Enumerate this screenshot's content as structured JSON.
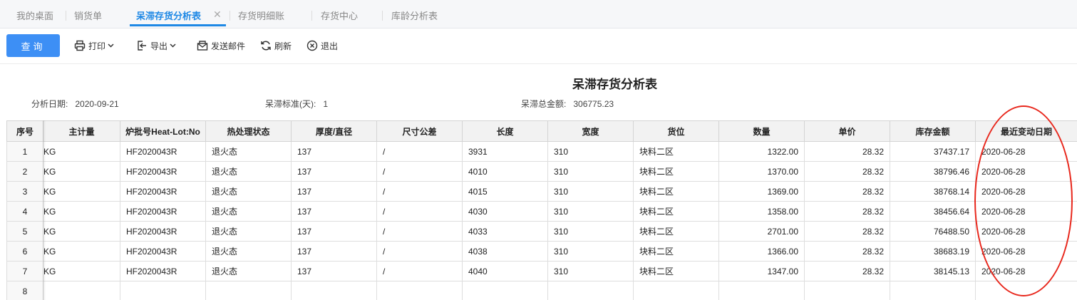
{
  "tabs": [
    {
      "label": "我的桌面",
      "active": false
    },
    {
      "label": "销货单",
      "active": false
    },
    {
      "label": "呆滞存货分析表",
      "active": true
    },
    {
      "label": "存货明细账",
      "active": false
    },
    {
      "label": "存货中心",
      "active": false
    },
    {
      "label": "库龄分析表",
      "active": false
    }
  ],
  "toolbar": {
    "query": "查询",
    "print": "打印",
    "export": "导出",
    "email": "发送邮件",
    "refresh": "刷新",
    "exit": "退出"
  },
  "report": {
    "title": "呆滞存货分析表",
    "analysis_date_label": "分析日期:",
    "analysis_date": "2020-09-21",
    "standard_label": "呆滞标准(天):",
    "standard": "1",
    "total_label": "呆滞总金额:",
    "total": "306775.23"
  },
  "table": {
    "columns": [
      "序号",
      "主计量",
      "炉批号Heat-Lot:No",
      "热处理状态",
      "厚度/直径",
      "尺寸公差",
      "长度",
      "宽度",
      "货位",
      "数量",
      "单价",
      "库存金额",
      "最近变动日期"
    ],
    "rows": [
      [
        "1",
        "KG",
        "HF2020043R",
        "退火态",
        "137",
        "/",
        "3931",
        "310",
        "块料二区",
        "1322.00",
        "28.32",
        "37437.17",
        "2020-06-28"
      ],
      [
        "2",
        "KG",
        "HF2020043R",
        "退火态",
        "137",
        "/",
        "4010",
        "310",
        "块料二区",
        "1370.00",
        "28.32",
        "38796.46",
        "2020-06-28"
      ],
      [
        "3",
        "KG",
        "HF2020043R",
        "退火态",
        "137",
        "/",
        "4015",
        "310",
        "块料二区",
        "1369.00",
        "28.32",
        "38768.14",
        "2020-06-28"
      ],
      [
        "4",
        "KG",
        "HF2020043R",
        "退火态",
        "137",
        "/",
        "4030",
        "310",
        "块料二区",
        "1358.00",
        "28.32",
        "38456.64",
        "2020-06-28"
      ],
      [
        "5",
        "KG",
        "HF2020043R",
        "退火态",
        "137",
        "/",
        "4033",
        "310",
        "块料二区",
        "2701.00",
        "28.32",
        "76488.50",
        "2020-06-28"
      ],
      [
        "6",
        "KG",
        "HF2020043R",
        "退火态",
        "137",
        "/",
        "4038",
        "310",
        "块料二区",
        "1366.00",
        "28.32",
        "38683.19",
        "2020-06-28"
      ],
      [
        "7",
        "KG",
        "HF2020043R",
        "退火态",
        "137",
        "/",
        "4040",
        "310",
        "块料二区",
        "1347.00",
        "28.32",
        "38145.13",
        "2020-06-28"
      ],
      [
        "8",
        "",
        "",
        "",
        "",
        "",
        "",
        "",
        "",
        "",
        "",
        "",
        ""
      ]
    ]
  },
  "colors": {
    "accent": "#1e88e5",
    "query_button": "#3d8ff5",
    "annotation": "#e8271c"
  }
}
